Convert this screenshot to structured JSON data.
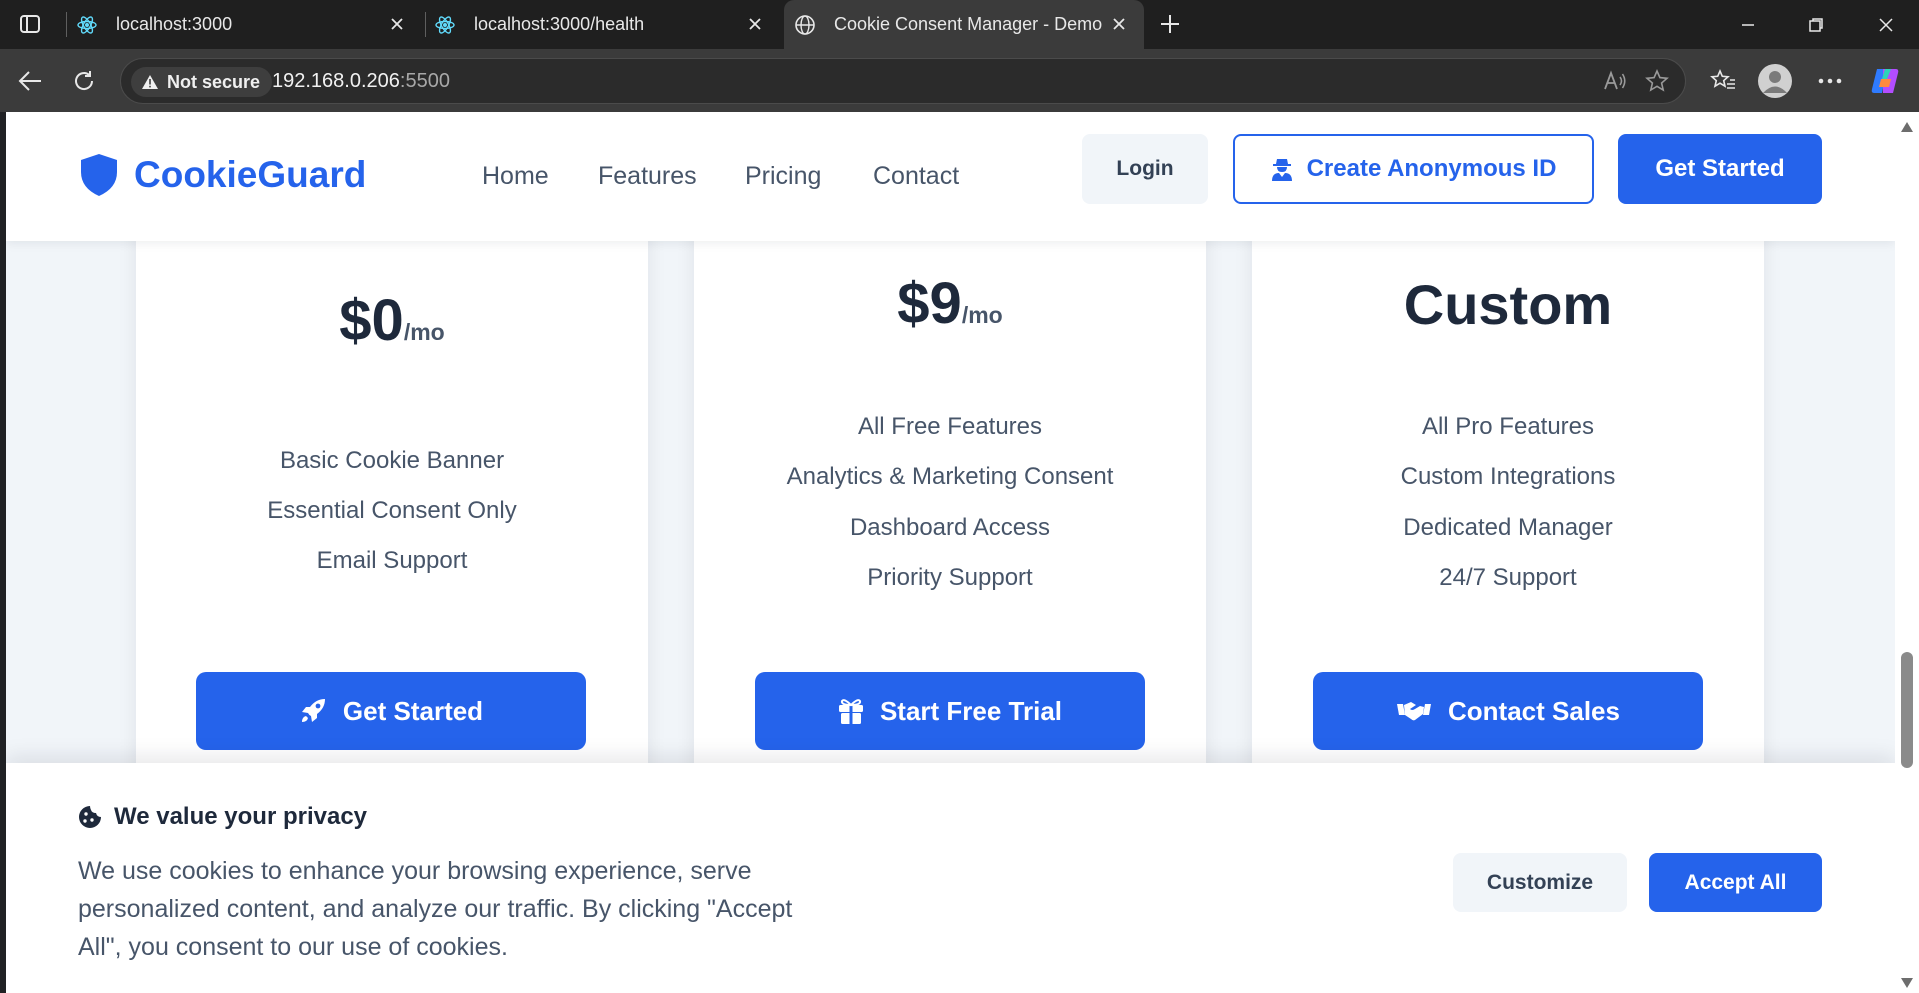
{
  "browser": {
    "tabs": [
      {
        "title": "localhost:3000",
        "icon": "react-icon",
        "active": false
      },
      {
        "title": "localhost:3000/health",
        "icon": "react-icon",
        "active": false
      },
      {
        "title": "Cookie Consent Manager - Demo",
        "icon": "globe-icon",
        "active": true
      }
    ],
    "security_label": "Not secure",
    "url_host": "192.168.0.206",
    "url_port": ":5500"
  },
  "header": {
    "brand": "CookieGuard",
    "nav": [
      "Home",
      "Features",
      "Pricing",
      "Contact"
    ],
    "login_label": "Login",
    "anon_label": "Create Anonymous ID",
    "get_started_label": "Get Started"
  },
  "pricing": {
    "plans": [
      {
        "amount": "$0",
        "period": "/mo",
        "features": [
          "Basic Cookie Banner",
          "Essential Consent Only",
          "Email Support"
        ],
        "cta": "Get Started",
        "cta_icon": "rocket-icon"
      },
      {
        "amount": "$9",
        "period": "/mo",
        "features": [
          "All Free Features",
          "Analytics & Marketing Consent",
          "Dashboard Access",
          "Priority Support"
        ],
        "cta": "Start Free Trial",
        "cta_icon": "gift-icon"
      },
      {
        "amount": "Custom",
        "features": [
          "All Pro Features",
          "Custom Integrations",
          "Dedicated Manager",
          "24/7 Support"
        ],
        "cta": "Contact Sales",
        "cta_icon": "handshake-icon"
      }
    ]
  },
  "cookie_banner": {
    "title": "We value your privacy",
    "description": "We use cookies to enhance your browsing experience, serve personalized content, and analyze our traffic. By clicking \"Accept All\", you consent to our use of cookies.",
    "customize_label": "Customize",
    "accept_label": "Accept All"
  },
  "colors": {
    "accent": "#2563eb",
    "page_bg": "#f1f5f9",
    "heading": "#1e293b",
    "muted": "#475569"
  }
}
